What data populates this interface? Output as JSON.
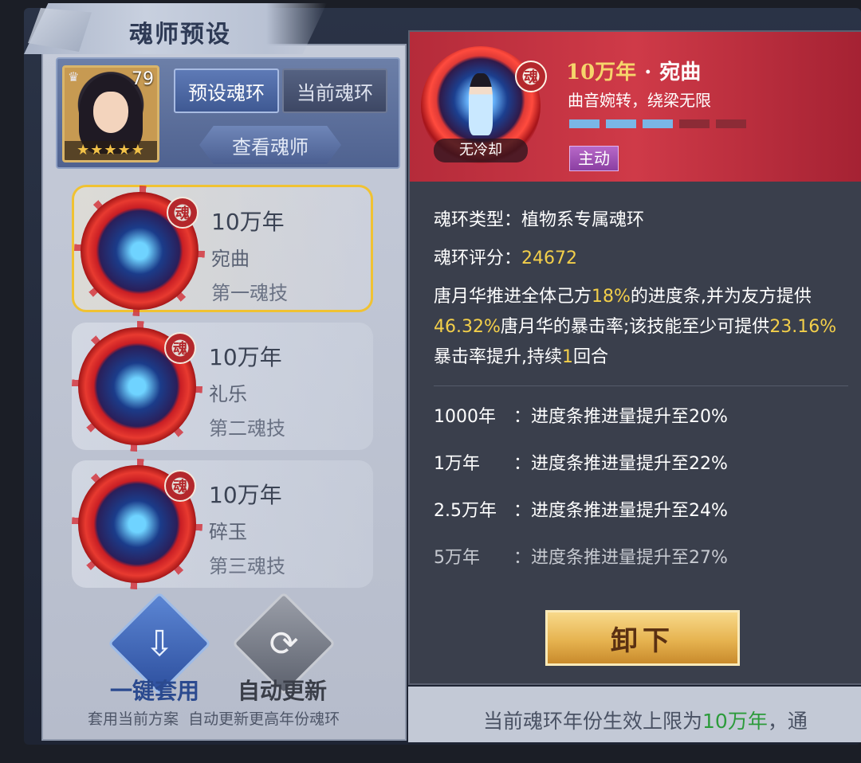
{
  "panel_title": "魂师预设",
  "hero": {
    "level": "79",
    "stars": "★★★★★",
    "rank_icon": "crown-icon"
  },
  "tabs": {
    "preset": "预设魂环",
    "current": "当前魂环"
  },
  "view_button": "查看魂师",
  "rings": [
    {
      "year": "10万年",
      "name": "宛曲",
      "slot": "第一魂技",
      "selected": true,
      "badge": "魂"
    },
    {
      "year": "10万年",
      "name": "礼乐",
      "slot": "第二魂技",
      "selected": false,
      "badge": "魂"
    },
    {
      "year": "10万年",
      "name": "碎玉",
      "slot": "第三魂技",
      "selected": false,
      "badge": "魂"
    }
  ],
  "actions": {
    "apply_label": "一键套用",
    "refresh_label": "自动更新",
    "apply_hint": "套用当前方案",
    "refresh_hint": "自动更新更高年份魂环",
    "apply_icon": "download-icon",
    "refresh_icon": "refresh-icon"
  },
  "detail": {
    "year": "10万年",
    "separator": "·",
    "name": "宛曲",
    "subtitle": "曲音婉转，绕梁无限",
    "cooldown": "无冷却",
    "level_bars": {
      "filled": 3,
      "total": 5
    },
    "tag": "主动",
    "badge": "魂",
    "type_label": "魂环类型：",
    "type_value": "植物系专属魂环",
    "score_label": "魂环评分：",
    "score_value": "24672",
    "effect": {
      "p1": "唐月华推进全体己方",
      "v1": "18%",
      "p2": "的进度条,并为友方提供",
      "v2": "46.32%",
      "p3": "唐月华的暴击率;该技能至少可提供",
      "v3": "23.16%",
      "p4": "暴击率提升,持续",
      "v4": "1",
      "p5": "回合"
    },
    "upgrades": [
      {
        "year": "1000年",
        "text": "：进度条推进量提升至20%"
      },
      {
        "year": "1万年",
        "text": "：进度条推进量提升至22%"
      },
      {
        "year": "2.5万年",
        "text": "：进度条推进量提升至24%"
      },
      {
        "year": "5万年",
        "text": "：进度条推进量提升至27%"
      }
    ],
    "unload_button": "卸下"
  },
  "footer": {
    "prefix": "当前魂环年份生效上限为",
    "highlight": "10万年",
    "suffix": "，通"
  },
  "colors": {
    "gold_text": "#f3cf4a",
    "header_red": "#cf3a48",
    "selected_border": "#f0c232",
    "footer_green": "#2c9b3b"
  }
}
